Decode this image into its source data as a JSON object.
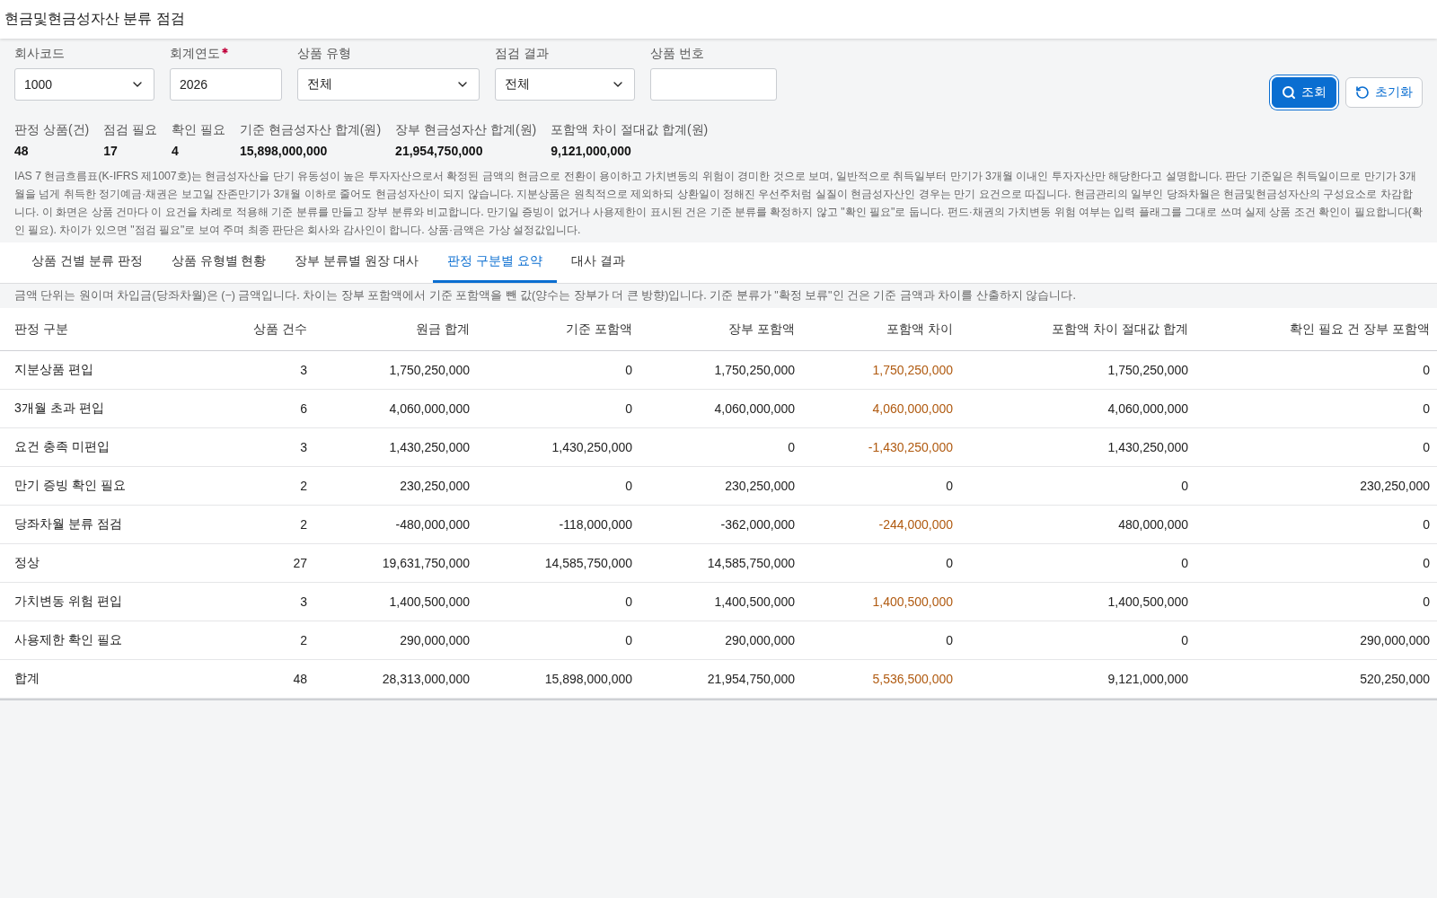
{
  "title": "현금및현금성자산 분류 점검",
  "filters": [
    {
      "kind": "select",
      "label": "회사코드",
      "value": "1000",
      "required": false
    },
    {
      "kind": "text",
      "label": "회계연도",
      "value": "2026",
      "required": true
    },
    {
      "kind": "select",
      "label": "상품 유형",
      "value": "전체",
      "required": false
    },
    {
      "kind": "select",
      "label": "점검 결과",
      "value": "전체",
      "required": false
    },
    {
      "kind": "text",
      "label": "상품 번호",
      "required": false
    }
  ],
  "buttons": [
    {
      "kind": "search",
      "label": "조회"
    },
    {
      "kind": "reset",
      "label": "초기화"
    }
  ],
  "stats": [
    {
      "label": "판정 상품(건)",
      "value": "48"
    },
    {
      "label": "점검 필요",
      "value": "17"
    },
    {
      "label": "확인 필요",
      "value": "4"
    },
    {
      "label": "기준 현금성자산 합계(원)",
      "value": "15,898,000,000"
    },
    {
      "label": "장부 현금성자산 합계(원)",
      "value": "21,954,750,000"
    },
    {
      "label": "포함액 차이 절대값 합계(원)",
      "value": "9,121,000,000"
    }
  ],
  "description": "IAS 7 현금흐름표(K-IFRS 제1007호)는 현금성자산을 단기 유동성이 높은 투자자산으로서 확정된 금액의 현금으로 전환이 용이하고 가치변동의 위험이 경미한 것으로 보며, 일반적으로 취득일부터 만기가 3개월 이내인 투자자산만 해당한다고 설명합니다. 판단 기준일은 취득일이므로 만기가 3개월을 넘게 취득한 정기예금·채권은 보고일 잔존만기가 3개월 이하로 줄어도 현금성자산이 되지 않습니다. 지분상품은 원칙적으로 제외하되 상환일이 정해진 우선주처럼 실질이 현금성자산인 경우는 만기 요건으로 따집니다. 현금관리의 일부인 당좌차월은 현금및현금성자산의 구성요소로 차감합니다. 이 화면은 상품 건마다 이 요건을 차례로 적용해 기준 분류를 만들고 장부 분류와 비교합니다. 만기일 증빙이 없거나 사용제한이 표시된 건은 기준 분류를 확정하지 않고 \"확인 필요\"로 둡니다. 펀드·채권의 가치변동 위험 여부는 입력 플래그를 그대로 쓰며 실제 상품 조건 확인이 필요합니다(확인 필요). 차이가 있으면 \"점검 필요\"로 보여 주며 최종 판단은 회사와 감사인이 합니다. 상품·금액은 가상 설정값입니다.",
  "tabs": [
    {
      "label": "상품 건별 분류 판정",
      "selected": false
    },
    {
      "label": "상품 유형별 현황",
      "selected": false
    },
    {
      "label": "장부 분류별 원장 대사",
      "selected": false
    },
    {
      "label": "판정 구분별 요약",
      "selected": true
    },
    {
      "label": "대사 결과",
      "selected": false
    }
  ],
  "note": "금액 단위는 원이며 차입금(당좌차월)은 (−) 금액입니다. 차이는 장부 포함액에서 기준 포함액을 뺀 값(양수는 장부가 더 큰 방향)입니다. 기준 분류가 \"확정 보류\"인 건은 기준 금액과 차이를 산출하지 않습니다.",
  "table": {
    "columns": [
      "판정 구분",
      "상품 건수",
      "원금 합계",
      "기준 포함액",
      "장부 포함액",
      "포함액 차이",
      "포함액 차이 절대값 합계",
      "확인 필요 건 장부 포함액"
    ],
    "rows": [
      {
        "cells": [
          "지분상품 편입",
          "3",
          "1,750,250,000",
          "0",
          "1,750,250,000",
          "1,750,250,000",
          "1,750,250,000",
          "0"
        ],
        "diff_flagged": true
      },
      {
        "cells": [
          "3개월 초과 편입",
          "6",
          "4,060,000,000",
          "0",
          "4,060,000,000",
          "4,060,000,000",
          "4,060,000,000",
          "0"
        ],
        "diff_flagged": true
      },
      {
        "cells": [
          "요건 충족 미편입",
          "3",
          "1,430,250,000",
          "1,430,250,000",
          "0",
          "-1,430,250,000",
          "1,430,250,000",
          "0"
        ],
        "diff_flagged": true
      },
      {
        "cells": [
          "만기 증빙 확인 필요",
          "2",
          "230,250,000",
          "0",
          "230,250,000",
          "0",
          "0",
          "230,250,000"
        ],
        "diff_flagged": false
      },
      {
        "cells": [
          "당좌차월 분류 점검",
          "2",
          "-480,000,000",
          "-118,000,000",
          "-362,000,000",
          "-244,000,000",
          "480,000,000",
          "0"
        ],
        "diff_flagged": true
      },
      {
        "cells": [
          "정상",
          "27",
          "19,631,750,000",
          "14,585,750,000",
          "14,585,750,000",
          "0",
          "0",
          "0"
        ],
        "diff_flagged": false
      },
      {
        "cells": [
          "가치변동 위험 편입",
          "3",
          "1,400,500,000",
          "0",
          "1,400,500,000",
          "1,400,500,000",
          "1,400,500,000",
          "0"
        ],
        "diff_flagged": true
      },
      {
        "cells": [
          "사용제한 확인 필요",
          "2",
          "290,000,000",
          "0",
          "290,000,000",
          "0",
          "0",
          "290,000,000"
        ],
        "diff_flagged": false
      },
      {
        "cells": [
          "합계",
          "48",
          "28,313,000,000",
          "15,898,000,000",
          "21,954,750,000",
          "5,536,500,000",
          "9,121,000,000",
          "520,250,000"
        ],
        "diff_flagged": true
      }
    ]
  }
}
